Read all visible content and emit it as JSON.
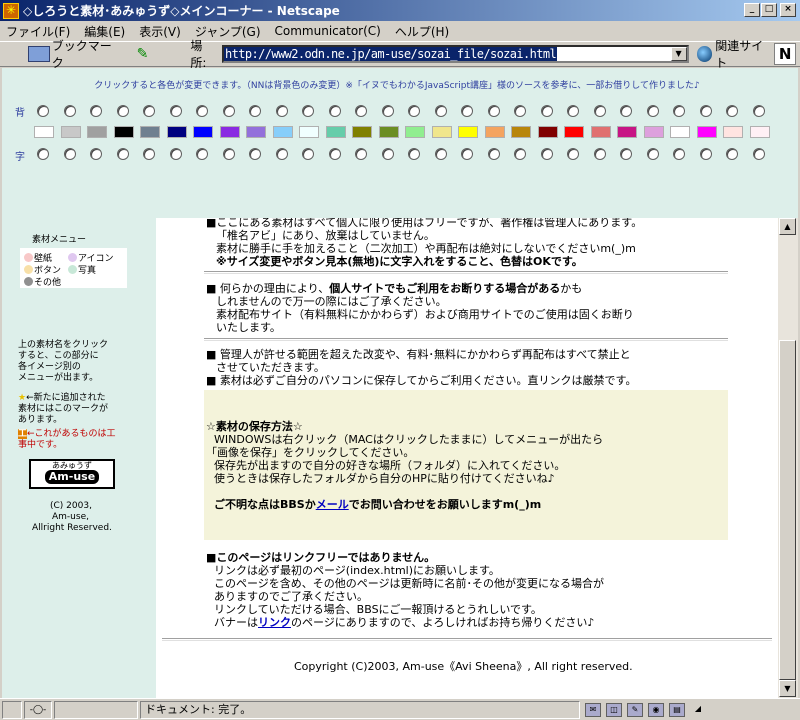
{
  "window": {
    "title": "◇しろうと素材･あみゅうず◇メインコーナー - Netscape"
  },
  "menu": [
    "ファイル(F)",
    "編集(E)",
    "表示(V)",
    "ジャンプ(G)",
    "Communicator(C)",
    "ヘルプ(H)"
  ],
  "toolbar": {
    "bookmark_label": "ブックマーク",
    "location_label": "場所:",
    "url": "http://www2.odn.ne.jp/am-use/sozai_file/sozai.html",
    "related_label": "関連サイト",
    "logo_letter": "N"
  },
  "picker": {
    "note": "クリックすると各色が変更できます。（NNは背景色のみ変更）※「イヌでもわかるJavaScript講座」様のソースを参考に、一部お借りして作りました♪",
    "bg_label": "背",
    "text_label": "字",
    "swatches": [
      "#ffffff",
      "#c8c8c8",
      "#a0a0a0",
      "#000000",
      "#708090",
      "#000080",
      "#0000ff",
      "#8a2be2",
      "#9370db",
      "#87cefa",
      "#f0ffff",
      "#66cdaa",
      "#808000",
      "#6b8e23",
      "#90ee90",
      "#f0e68c",
      "#ffff00",
      "#f4a460",
      "#b8860b",
      "#800000",
      "#ff0000",
      "#e07070",
      "#c71585",
      "#dda0dd",
      "#ffffff",
      "#ff00ff",
      "#ffe4e1",
      "#fff0f5"
    ]
  },
  "left": {
    "menu_title": "素材メニュー",
    "menu_items": [
      {
        "label": "壁紙",
        "color": "#f8c8c8"
      },
      {
        "label": "アイコン",
        "color": "#e0c8f0"
      },
      {
        "label": "ボタン",
        "color": "#f8e0a8"
      },
      {
        "label": "写真",
        "color": "#c8e8d8"
      },
      {
        "label": "その他",
        "color": "#909090"
      }
    ],
    "help1": "上の素材名をクリック",
    "help2": "すると、この部分に",
    "help3": "各イメージ別の",
    "help4": "メニューが出ます。",
    "new_mark": "★",
    "new1": "←新たに追加された",
    "new2": "素材にはこのマークが",
    "new3": "あります。",
    "wip_mark": "工",
    "wip1": "←これがあるものは工",
    "wip2": "事中です。",
    "logo_small": "あみゅうず",
    "logo_big": "Am-use",
    "copy1": "(C) 2003,",
    "copy2": "Am-use,",
    "copy3": "Allright Reserved."
  },
  "main": {
    "p1_l0": "■ここにある素材はすべて個人に限り使用はフリーですが、著作権は管理人にあります。",
    "p1_l1": "「椎名アビ」にあり、放棄はしていません。",
    "p1_l2": "素材に勝手に手を加えること（二次加工）や再配布は絶対にしないでくださいm(_)m",
    "p1_l3": "※サイズ変更やボタン見本(無地)に文字入れをすること、色替はOKです。",
    "p2_l1_a": "■ 何らかの理由により、",
    "p2_l1_b": "個人サイトでもご利用をお断りする場合がある",
    "p2_l1_c": "かも",
    "p2_l2": "しれませんので万一の際にはご了承ください。",
    "p2_l3": "素材配布サイト（有料無料にかかわらず）および商用サイトでのご使用は固くお断り",
    "p2_l4": "いたします。",
    "p3_l1": "■ 管理人が許せる範囲を超えた改変や、有料･無料にかかわらず再配布はすべて禁止と",
    "p3_l2": "させていただきます。",
    "p3_l3": "■ 素材は必ずご自分のパソコンに保存してからご利用ください。直リンクは厳禁です。",
    "save_title": "☆素材の保存方法☆",
    "save_l1": "WINDOWSは右クリック（MACはクリックしたままに）してメニューが出たら",
    "save_l2": "「画像を保存」をクリックしてください。",
    "save_l3": "保存先が出ますので自分の好きな場所（フォルダ）に入れてください。",
    "save_l4": "使うときは保存したフォルダから自分のHPに貼り付けてくださいね♪",
    "q_a": "ご不明な点はBBSか",
    "q_link": "メール",
    "q_b": "でお問い合わせをお願いしますm(_)m",
    "link_title": "■このページはリンクフリーではありません。",
    "link_l1": "リンクは必ず最初のページ(index.html)にお願いします。",
    "link_l2": "このページを含め、その他のページは更新時に名前･その他が変更になる場合が",
    "link_l3": "ありますのでご了承ください。",
    "link_l4": "リンクしていただける場合、BBSにご一報頂けるとうれしいです。",
    "link_l5_a": "バナーは",
    "link_l5_link": "リンク",
    "link_l5_b": "のページにありますので、よろしければお持ち帰りください♪",
    "footer": "Copyright (C)2003, Am-use《Avi Sheena》, All right reserved."
  },
  "status": {
    "text": "ドキュメント: 完了。"
  }
}
